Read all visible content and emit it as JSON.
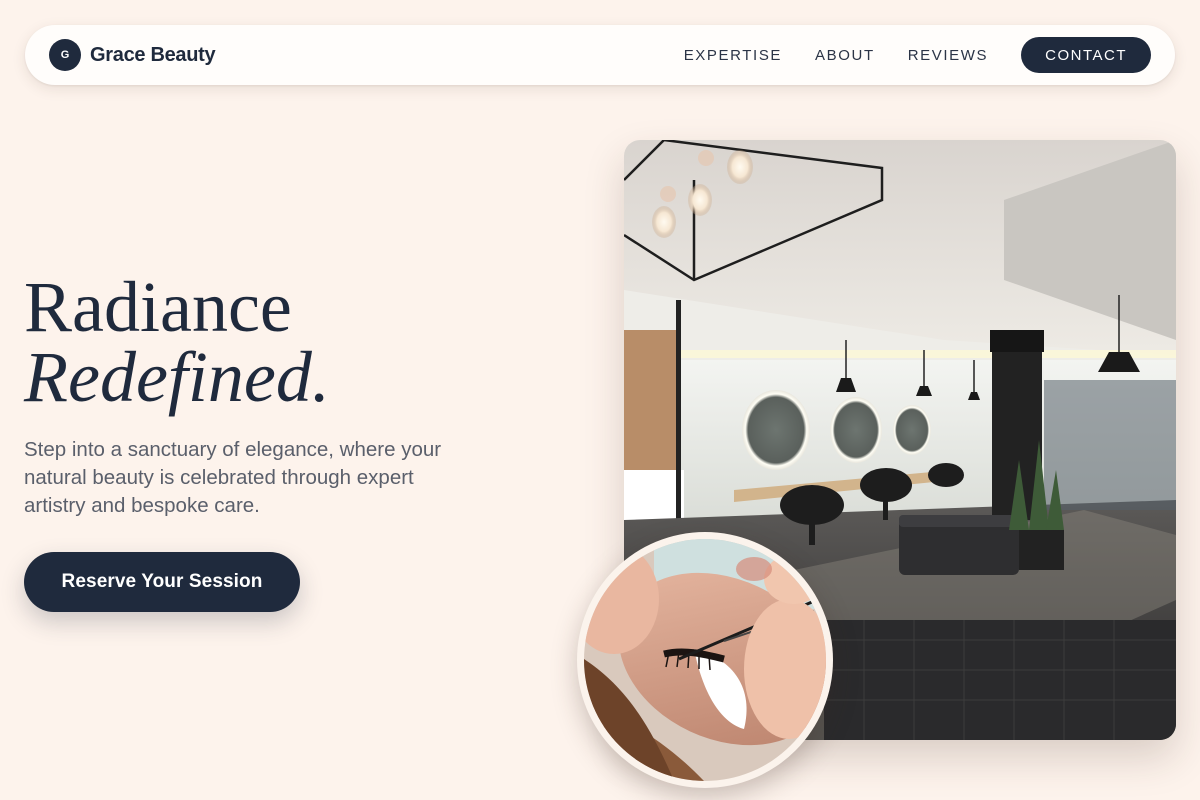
{
  "brand": {
    "logo_letter": "G",
    "name": "Grace Beauty"
  },
  "nav": {
    "links": [
      "EXPERTISE",
      "ABOUT",
      "REVIEWS"
    ],
    "cta": "CONTACT"
  },
  "hero": {
    "title_line1": "Radiance",
    "title_line2": "Redefined.",
    "subtitle": "Step into a sanctuary of elegance, where your natural beauty is celebrated through expert artistry and bespoke care.",
    "cta": "Reserve Your Session"
  },
  "images": {
    "salon": "salon-interior-photo",
    "lash": "lash-treatment-photo"
  },
  "colors": {
    "background": "#fdf3ec",
    "navy": "#1f2a3d",
    "nav_bg": "#fffdfb",
    "text_muted": "#5a5f6b"
  }
}
